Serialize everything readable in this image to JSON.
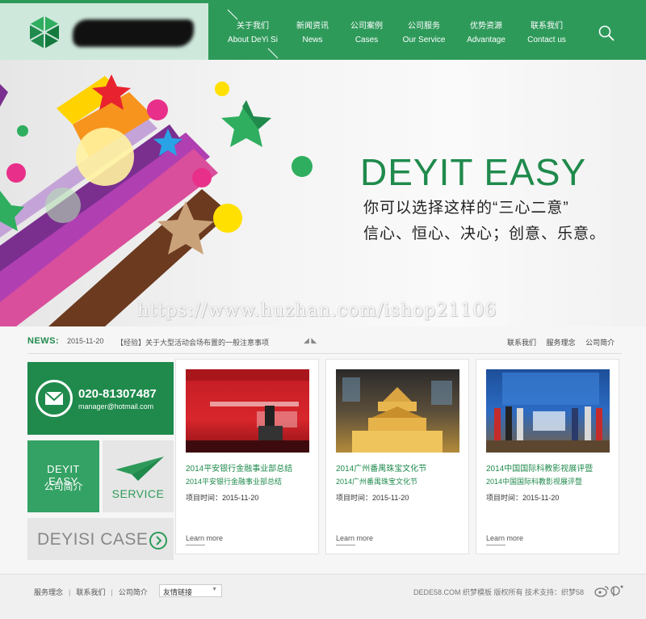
{
  "colors": {
    "brand_green": "#2e9a5a",
    "dark_green": "#1f8a4c",
    "logo_bg": "#cfe8dc"
  },
  "nav": {
    "items": [
      {
        "cn": "关于我们",
        "en": "About DeYi Si"
      },
      {
        "cn": "新闻资讯",
        "en": "News"
      },
      {
        "cn": "公司案例",
        "en": "Cases"
      },
      {
        "cn": "公司服务",
        "en": "Our Service"
      },
      {
        "cn": "优势资源",
        "en": "Advantage"
      },
      {
        "cn": "联系我们",
        "en": "Contact us"
      }
    ],
    "search_icon": "search-icon"
  },
  "banner": {
    "brand": "DEYIT EASY",
    "line1": "你可以选择这样的“三心二意”",
    "line2": "信心、恒心、决心；创意、乐意。",
    "watermark": "https://www.huzhan.com/ishop21106"
  },
  "news": {
    "label": "NEWS:",
    "date": "2015-11-20",
    "title": "【经验】关于大型活动会场布置的一般注意事项",
    "arrows": "◢ ◣",
    "links": [
      "联系我们",
      "服务理念",
      "公司简介"
    ]
  },
  "contact": {
    "phone": "020-81307487",
    "email": "manager@hotmail.com"
  },
  "tiles": {
    "about_brand": "DEYIT EASY",
    "about_label": "公司简介",
    "service_label": "SERVICE",
    "case_label": "DEYISI CASE"
  },
  "cards": [
    {
      "title": "2014平安银行金融事业部总结",
      "subtitle": "2014平安银行金融事业部总结",
      "date": "项目时间：2015-11-20",
      "more": "Learn more"
    },
    {
      "title": "2014广州番禺珠宝文化节",
      "subtitle": "2014广州番禺珠宝文化节",
      "date": "项目时间：2015-11-20",
      "more": "Learn more"
    },
    {
      "title": "2014中国国际科教影视展评暨",
      "subtitle": "2014中国国际科教影视展评暨",
      "date": "项目时间：2015-11-20",
      "more": "Learn more"
    }
  ],
  "footer": {
    "links": [
      "服务理念",
      "联系我们",
      "公司简介"
    ],
    "select_value": "友情链接",
    "copyright": "DEDE58.COM 织梦模板 版权所有    技术支持：织梦58"
  }
}
